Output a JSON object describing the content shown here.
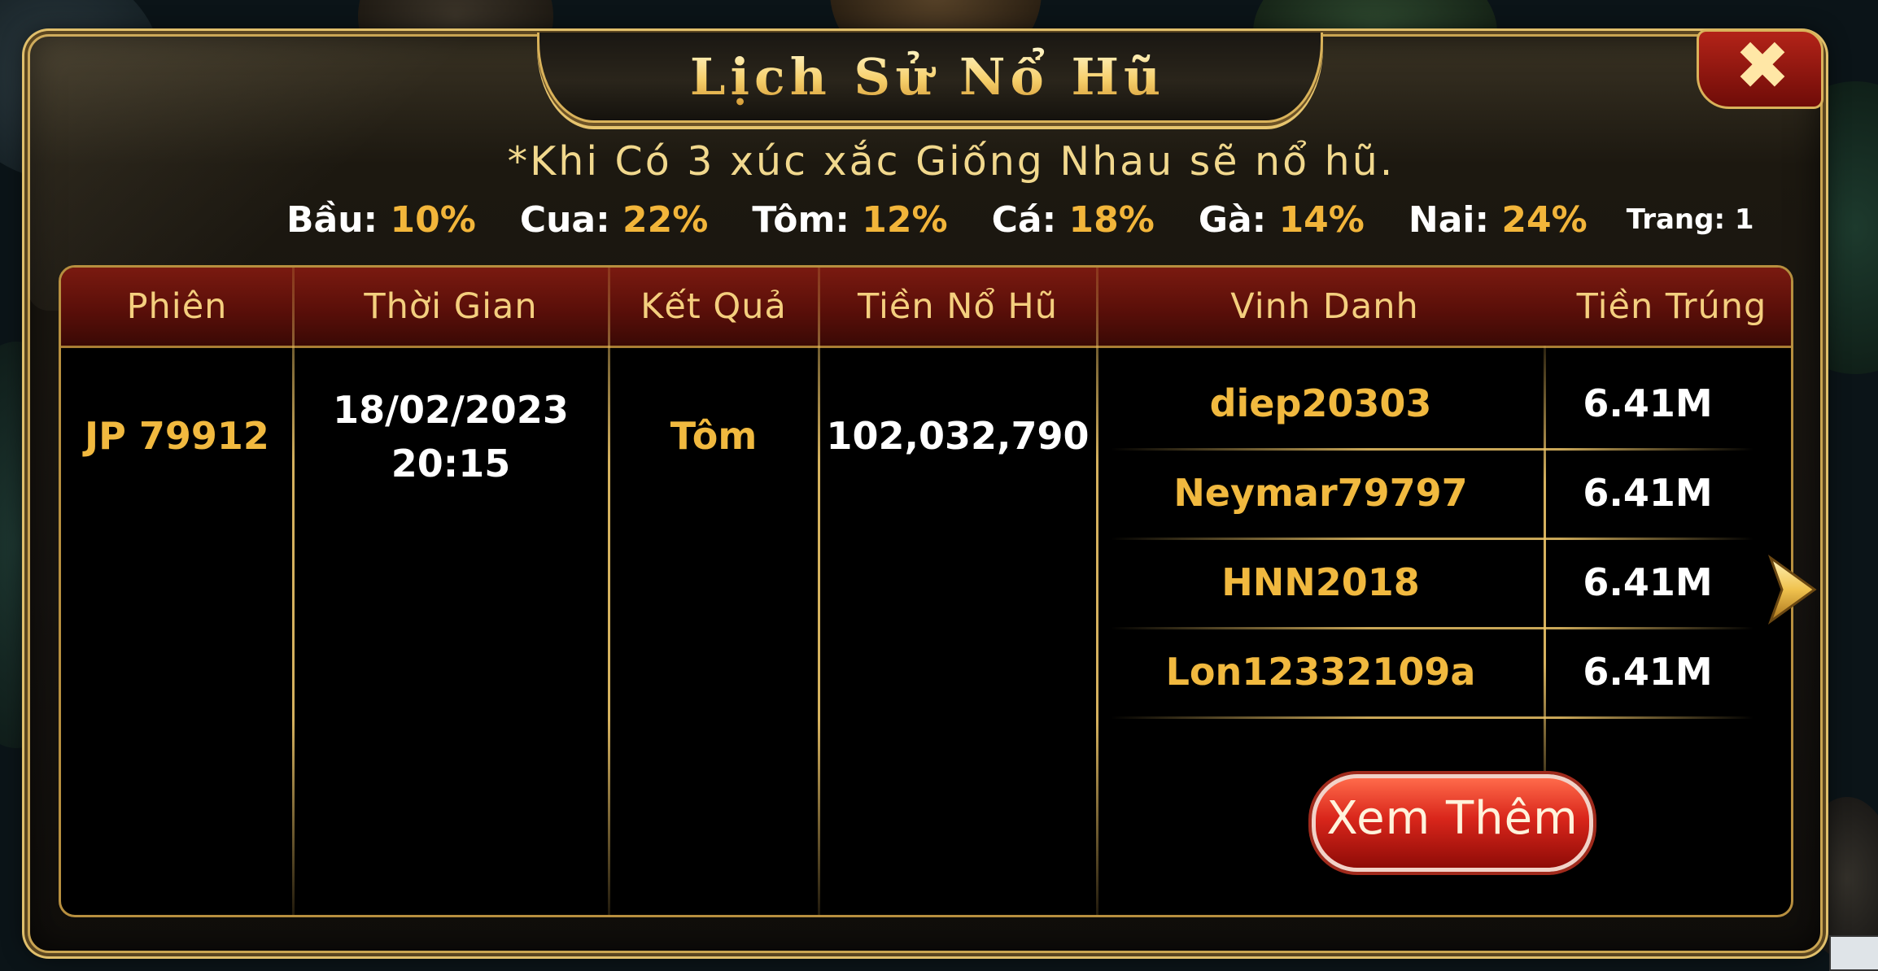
{
  "title": "Lịch Sử Nổ Hũ",
  "rule": "*Khi Có 3 xúc xắc Giống Nhau sẽ nổ hũ.",
  "odds": [
    {
      "name": "Bầu:",
      "value": "10%"
    },
    {
      "name": "Cua:",
      "value": "22%"
    },
    {
      "name": "Tôm:",
      "value": "12%"
    },
    {
      "name": "Cá:",
      "value": "18%"
    },
    {
      "name": "Gà:",
      "value": "14%"
    },
    {
      "name": "Nai:",
      "value": "24%"
    }
  ],
  "page_label": "Trang: 1",
  "table": {
    "headers": {
      "session": "Phiên",
      "time": "Thời Gian",
      "result": "Kết Quả",
      "jackpot": "Tiền Nổ Hũ",
      "honor": "Vinh Danh",
      "prize": "Tiền Trúng"
    },
    "row": {
      "session": "JP 79912",
      "date": "18/02/2023",
      "time": "20:15",
      "result": "Tôm",
      "jackpot": "102,032,790"
    },
    "winners": [
      {
        "name": "diep20303",
        "amount": "6.41M"
      },
      {
        "name": "Neymar79797",
        "amount": "6.41M"
      },
      {
        "name": "HNN2018",
        "amount": "6.41M"
      },
      {
        "name": "Lon12332109a",
        "amount": "6.41M"
      }
    ]
  },
  "buttons": {
    "close": "✖",
    "more": "Xem Thêm"
  },
  "icons": {
    "close": "close-icon",
    "next": "chevron-right-icon"
  },
  "colors": {
    "gold_text": "#f1b93f",
    "header_red": "#6a130c",
    "frame_gold": "#c9a451",
    "button_red": "#d9261b"
  }
}
